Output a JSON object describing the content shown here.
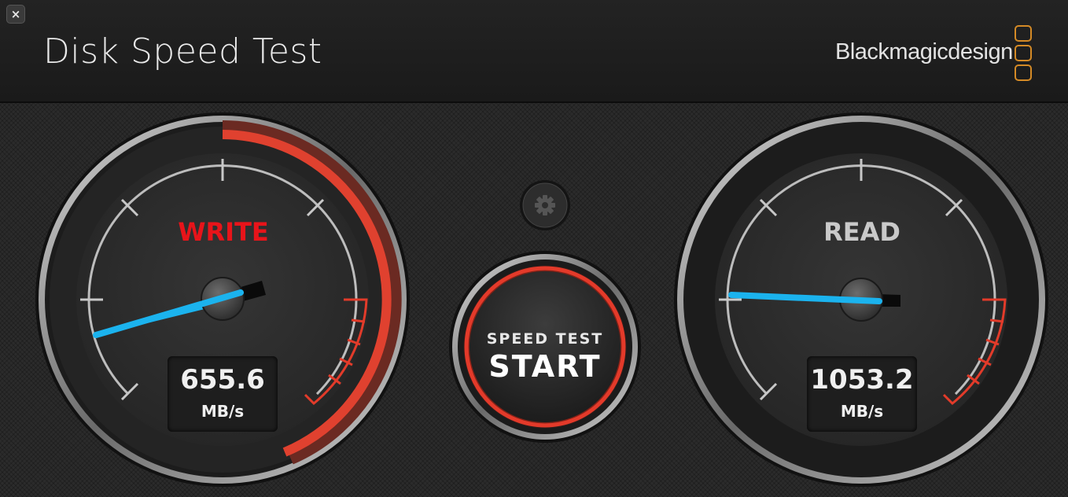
{
  "window": {
    "title": "Disk Speed Test",
    "close_glyph": "×",
    "brand": "Blackmagicdesign",
    "brand_color": "#d48a26"
  },
  "settings": {
    "icon": "gear-icon"
  },
  "write": {
    "label": "WRITE",
    "label_color": "#e8141a",
    "value": "655.6",
    "unit": "MB/s",
    "needle_color": "#1bb3ee"
  },
  "read": {
    "label": "READ",
    "label_color": "#c9c9c9",
    "value": "1053.2",
    "unit": "MB/s",
    "needle_color": "#1bb3ee"
  },
  "start": {
    "line1": "SPEED TEST",
    "line2": "START",
    "ring_color": "#e33a2a"
  }
}
